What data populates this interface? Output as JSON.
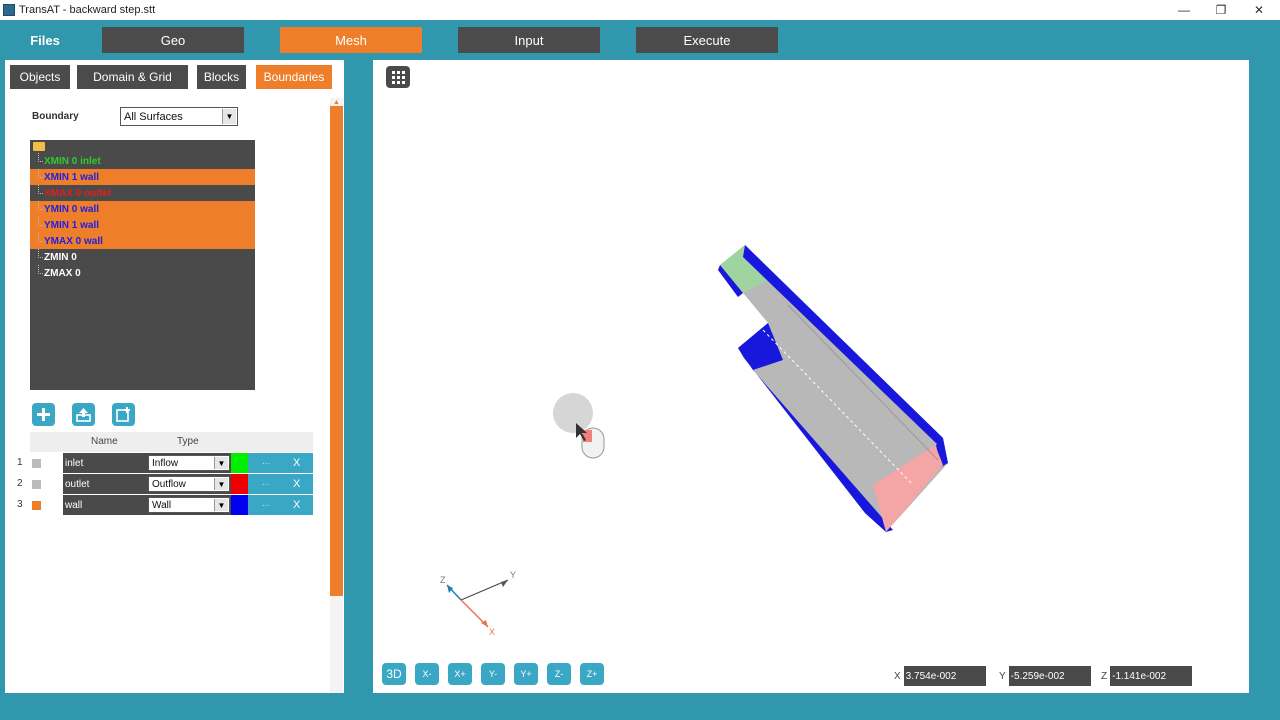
{
  "window": {
    "title": "TransAT - backward step.stt"
  },
  "mainnav": {
    "files": "Files",
    "tabs": [
      {
        "label": "Geo"
      },
      {
        "label": "Mesh"
      },
      {
        "label": "Input"
      },
      {
        "label": "Execute"
      }
    ]
  },
  "subtabs": [
    {
      "label": "Objects"
    },
    {
      "label": "Domain & Grid"
    },
    {
      "label": "Blocks"
    },
    {
      "label": "Boundaries"
    }
  ],
  "boundary": {
    "label": "Boundary",
    "selected": "All Surfaces"
  },
  "tree": {
    "items": [
      {
        "label": "XMIN 0 inlet",
        "color": "#2ecc2e",
        "bg": "#4a4a4a"
      },
      {
        "label": "XMIN 1 wall",
        "color": "#2020e0",
        "bg": "#ef7e2b"
      },
      {
        "label": "XMAX 0 outlet",
        "color": "#e02020",
        "bg": "#4a4a4a"
      },
      {
        "label": "YMIN 0 wall",
        "color": "#2020e0",
        "bg": "#ef7e2b"
      },
      {
        "label": "YMIN 1 wall",
        "color": "#2020e0",
        "bg": "#ef7e2b"
      },
      {
        "label": "YMAX 0 wall",
        "color": "#2020e0",
        "bg": "#ef7e2b"
      },
      {
        "label": "ZMIN 0",
        "color": "#ffffff",
        "bg": "#4a4a4a"
      },
      {
        "label": "ZMAX 0",
        "color": "#ffffff",
        "bg": "#4a4a4a"
      }
    ]
  },
  "grid": {
    "col_name": "Name",
    "col_type": "Type",
    "rows": [
      {
        "num": "1",
        "name": "inlet",
        "type": "Inflow",
        "color": "#00ee00",
        "check": "#bbbbbb",
        "dots": "...",
        "remove": "X"
      },
      {
        "num": "2",
        "name": "outlet",
        "type": "Outflow",
        "color": "#ee0000",
        "check": "#bbbbbb",
        "dots": "...",
        "remove": "X"
      },
      {
        "num": "3",
        "name": "wall",
        "type": "Wall",
        "color": "#0000ee",
        "check": "#ef7e2b",
        "dots": "...",
        "remove": "X"
      }
    ]
  },
  "triad": {
    "x": "X",
    "y": "Y",
    "z": "Z"
  },
  "viewbuttons": [
    {
      "label": "3D"
    },
    {
      "label": "X-"
    },
    {
      "label": "X+"
    },
    {
      "label": "Y-"
    },
    {
      "label": "Y+"
    },
    {
      "label": "Z-"
    },
    {
      "label": "Z+"
    }
  ],
  "coords": {
    "x_label": "X",
    "x_value": "3.754e-002",
    "y_label": "Y",
    "y_value": "-5.259e-002",
    "z_label": "Z",
    "z_value": "-1.141e-002"
  },
  "colors": {
    "accent": "#ef7e2b",
    "background": "#3197ad",
    "dark": "#4b4b4b",
    "button": "#3aa7c5"
  }
}
